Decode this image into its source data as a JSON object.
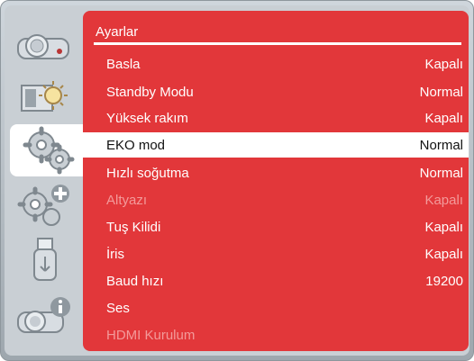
{
  "panel": {
    "title": "Ayarlar"
  },
  "sidebar": {
    "items": [
      {
        "icon": "projector-icon"
      },
      {
        "icon": "image-settings-icon"
      },
      {
        "icon": "gears-icon"
      },
      {
        "icon": "gears-plus-icon"
      },
      {
        "icon": "usb-icon"
      },
      {
        "icon": "projector-info-icon"
      }
    ]
  },
  "rows": [
    {
      "label": "Basla",
      "value": "Kapalı"
    },
    {
      "label": "Standby Modu",
      "value": "Normal"
    },
    {
      "label": "Yüksek rakım",
      "value": "Kapalı"
    },
    {
      "label": "EKO mod",
      "value": "Normal"
    },
    {
      "label": "Hızlı soğutma",
      "value": "Normal"
    },
    {
      "label": "Altyazı",
      "value": "Kapalı"
    },
    {
      "label": "Tuş Kilidi",
      "value": "Kapalı"
    },
    {
      "label": "İris",
      "value": "Kapalı"
    },
    {
      "label": "Baud hızı",
      "value": "19200"
    },
    {
      "label": "Ses",
      "value": ""
    },
    {
      "label": "HDMI Kurulum",
      "value": ""
    }
  ],
  "colors": {
    "accent": "#e2373a",
    "frame": "#c9cfd4",
    "disabled_text": "#f39a9a"
  }
}
